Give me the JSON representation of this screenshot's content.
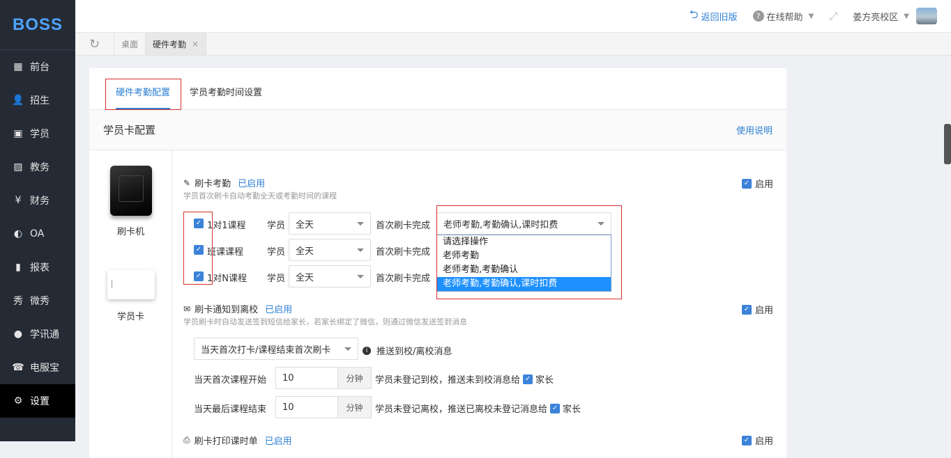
{
  "app": {
    "logo": "BOSS"
  },
  "sidebar": {
    "items": [
      {
        "label": "前台",
        "icon": "calendar-icon"
      },
      {
        "label": "招生",
        "icon": "user-add-icon"
      },
      {
        "label": "学员",
        "icon": "id-card-icon"
      },
      {
        "label": "教务",
        "icon": "picture-icon"
      },
      {
        "label": "财务",
        "icon": "yen-icon"
      },
      {
        "label": "OA",
        "icon": "toggle-icon"
      },
      {
        "label": "报表",
        "icon": "bar-chart-icon"
      },
      {
        "label": "微秀",
        "icon": "wei-icon"
      },
      {
        "label": "学讯通",
        "icon": "location-icon"
      },
      {
        "label": "电服宝",
        "icon": "phone-icon"
      },
      {
        "label": "设置",
        "icon": "gear-icon"
      }
    ],
    "active_index": 10
  },
  "topbar": {
    "back_label": "返回旧版",
    "help_label": "在线帮助",
    "campus_label": "姜方亮校区"
  },
  "tabs": {
    "items": [
      {
        "label": "桌面"
      },
      {
        "label": "硬件考勤"
      }
    ],
    "close_glyph": "×"
  },
  "subtabs": [
    {
      "label": "硬件考勤配置"
    },
    {
      "label": "学员考勤时间设置"
    }
  ],
  "section": {
    "title": "学员卡配置",
    "help_link": "使用说明"
  },
  "devices": [
    {
      "label": "刷卡机"
    },
    {
      "label": "学员卡"
    }
  ],
  "swipe": {
    "title": "刷卡考勤",
    "status": "已启用",
    "desc": "学员首次刷卡自动考勤全天或考勤时间的课程",
    "enable_label": "启用",
    "rows": [
      {
        "course": "1对1课程",
        "role": "学员",
        "scope": "全天",
        "action_label": "首次刷卡完成"
      },
      {
        "course": "班课课程",
        "role": "学员",
        "scope": "全天",
        "action_label": "首次刷卡完成"
      },
      {
        "course": "1对N课程",
        "role": "学员",
        "scope": "全天",
        "action_label": "首次刷卡完成"
      }
    ],
    "action_value": "老师考勤,考勤确认,课时扣费",
    "action_options": [
      "请选择操作",
      "老师考勤",
      "老师考勤,考勤确认",
      "老师考勤,考勤确认,课时扣费"
    ],
    "selected_option_index": 3
  },
  "notify": {
    "title": "刷卡通知到离校",
    "status": "已启用",
    "desc": "学员刷卡时自动发送签到短信给家长，若家长绑定了微信，则通过微信发送签到消息",
    "enable_label": "启用",
    "mode_value": "当天首次打卡/课程结束首次刷卡",
    "push_label": "推送到校/离校消息",
    "start": {
      "label": "当天首次课程开始",
      "value": "10",
      "unit": "分钟",
      "text": "学员未登记到校，推送未到校消息给",
      "parent": "家长"
    },
    "end": {
      "label": "当天最后课程结束",
      "value": "10",
      "unit": "分钟",
      "text": "学员未登记离校，推送已离校未登记消息给",
      "parent": "家长"
    }
  },
  "print": {
    "title": "刷卡打印课时单",
    "status": "已启用",
    "enable_label": "启用"
  }
}
